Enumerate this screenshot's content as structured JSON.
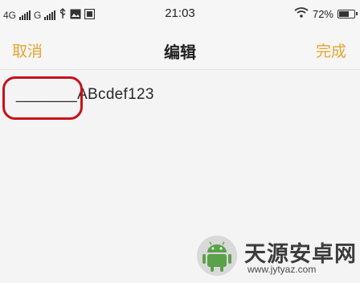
{
  "status_bar": {
    "network_1": "4G",
    "network_2": "G",
    "time": "21:03",
    "battery_percent": "72%",
    "battery_level": 0.72
  },
  "nav": {
    "cancel_label": "取消",
    "title": "编辑",
    "done_label": "完成"
  },
  "editor": {
    "text": "_______ABcdef123"
  },
  "watermark": {
    "brand": "天源安卓网",
    "url": "www.jytyaz.com"
  },
  "colors": {
    "accent": "#e5a432",
    "highlight": "#c8101c"
  }
}
